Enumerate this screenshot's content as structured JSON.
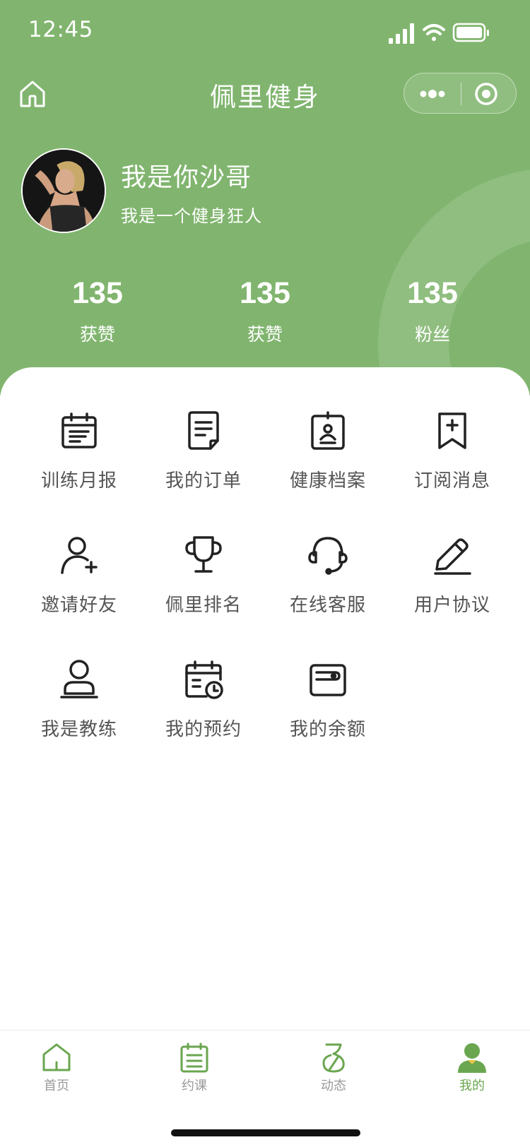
{
  "status_bar": {
    "time": "12:45"
  },
  "nav": {
    "title": "佩里健身"
  },
  "profile": {
    "name": "我是你沙哥",
    "bio": "我是一个健身狂人"
  },
  "stats": [
    {
      "value": "135",
      "label": "获赞"
    },
    {
      "value": "135",
      "label": "获赞"
    },
    {
      "value": "135",
      "label": "粉丝"
    }
  ],
  "menu": [
    {
      "label": "训练月报",
      "icon": "calendar-report-icon"
    },
    {
      "label": "我的订单",
      "icon": "order-document-icon"
    },
    {
      "label": "健康档案",
      "icon": "health-record-icon"
    },
    {
      "label": "订阅消息",
      "icon": "bookmark-plus-icon"
    },
    {
      "label": "邀请好友",
      "icon": "user-plus-icon"
    },
    {
      "label": "佩里排名",
      "icon": "trophy-icon"
    },
    {
      "label": "在线客服",
      "icon": "headset-icon"
    },
    {
      "label": "用户协议",
      "icon": "pen-icon"
    },
    {
      "label": "我是教练",
      "icon": "coach-icon"
    },
    {
      "label": "我的预约",
      "icon": "calendar-clock-icon"
    },
    {
      "label": "我的余额",
      "icon": "wallet-icon"
    }
  ],
  "tabbar": {
    "items": [
      {
        "label": "首页",
        "icon": "home-icon"
      },
      {
        "label": "约课",
        "icon": "schedule-icon"
      },
      {
        "label": "动态",
        "icon": "feed-icon"
      },
      {
        "label": "我的",
        "icon": "profile-icon",
        "active": true
      }
    ]
  },
  "colors": {
    "brand_green": "#81b56f",
    "active_tab": "#6aa64f",
    "menu_text": "#555555",
    "icon_stroke": "#222222"
  }
}
